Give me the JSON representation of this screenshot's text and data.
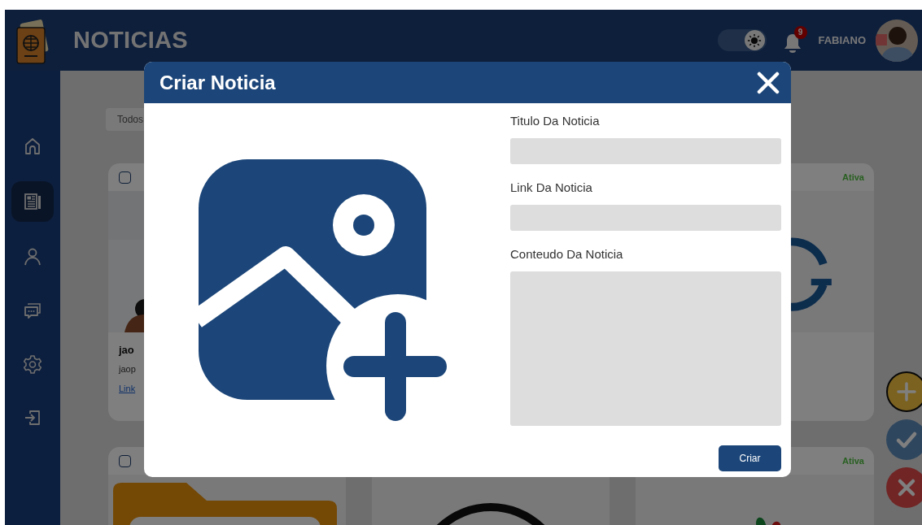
{
  "header": {
    "title": "NOTICIAS",
    "theme_toggle": {
      "on": true
    },
    "notifications": {
      "count": "9"
    },
    "user": {
      "name": "FABIANO"
    }
  },
  "sidebar": {
    "items": [
      {
        "selected": false
      },
      {
        "selected": true
      },
      {
        "selected": false
      },
      {
        "selected": false
      },
      {
        "selected": false
      },
      {
        "selected": false
      }
    ]
  },
  "filter": {
    "value": "Todos"
  },
  "cards": [
    [
      {
        "checked": false,
        "kind": "picture",
        "title": "jao",
        "description": "jaop",
        "link": "Link"
      },
      {
        "status": "Ativa",
        "kind": "picture"
      }
    ],
    [
      {
        "checked": false,
        "kind": "picture"
      },
      {
        "kind": "picture"
      },
      {
        "status": "Ativa",
        "kind": "picture"
      }
    ]
  ],
  "fabs": [
    {
      "kind": "add"
    },
    {
      "kind": "approve"
    },
    {
      "kind": "reject"
    }
  ],
  "modal": {
    "title": "Criar Noticia",
    "fields": [
      {
        "label": "Titulo Da Noticia",
        "kind": "input"
      },
      {
        "label": "Link Da Noticia",
        "kind": "input"
      },
      {
        "label": "Conteudo Da Noticia",
        "kind": "textarea"
      }
    ],
    "submit": "Criar"
  }
}
